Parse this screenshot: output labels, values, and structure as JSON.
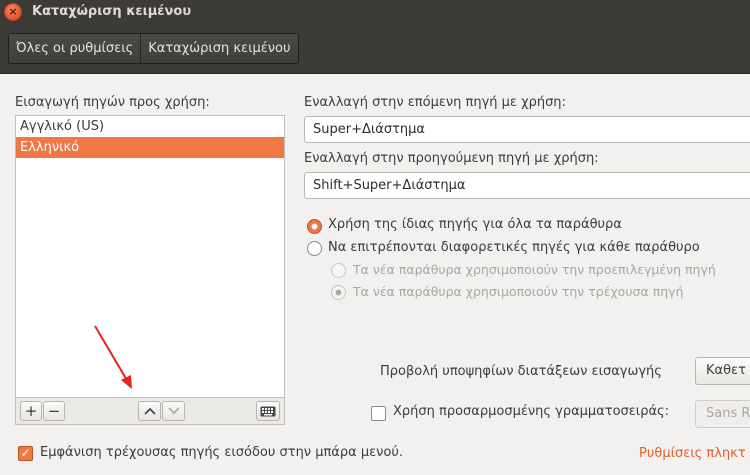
{
  "window": {
    "title": "Καταχώριση κειμένου",
    "close_glyph": "×"
  },
  "toolbar": {
    "all_settings": "Όλες οι ρυθμίσεις",
    "current": "Καταχώριση κειμένου"
  },
  "sources": {
    "label": "Εισαγωγή πηγών προς χρήση:",
    "items": [
      {
        "label": "Αγγλικό (US)",
        "selected": false
      },
      {
        "label": "Ελληνικό",
        "selected": true
      }
    ],
    "add_glyph": "+",
    "remove_glyph": "−",
    "up_glyph": "^",
    "down_glyph": "⌄",
    "keyboard_icon": "keyboard-icon"
  },
  "switching": {
    "next_label": "Εναλλαγή στην επόμενη πηγή με χρήση:",
    "next_value": "Super+Διάστημα",
    "prev_label": "Εναλλαγή στην προηγούμενη πηγή με χρήση:",
    "prev_value": "Shift+Super+Διάστημα"
  },
  "options": {
    "same_source": "Χρήση της ίδιας πηγής για όλα τα παράθυρα",
    "different_sources": "Να επιτρέπονται διαφορετικές πηγές για κάθε παράθυρο",
    "new_default": "Τα νέα παράθυρα χρησιμοποιούν την προεπιλεγμένη πηγή",
    "new_current": "Τα νέα παράθυρα χρησιμοποιούν την τρέχουσα πηγή"
  },
  "candidates": {
    "label": "Προβολή υποψηφίων διατάξεων εισαγωγής",
    "value": "Καθετ"
  },
  "custom_font": {
    "label": "Χρήση προσαρμοσμένης γραμματοσειράς:",
    "value": "Sans R"
  },
  "show_in_menu": "Εμφάνιση τρέχουσας πηγής εισόδου στην μπάρα μενού.",
  "keyboard_settings_link": "Ρυθμίσεις πληκτ",
  "accent_color": "#f07746"
}
